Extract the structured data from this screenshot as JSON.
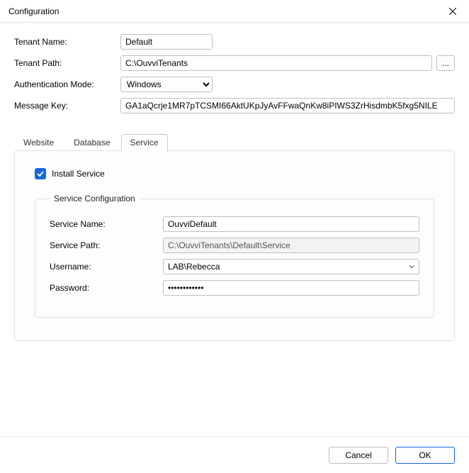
{
  "window": {
    "title": "Configuration"
  },
  "form": {
    "tenant_name_label": "Tenant Name:",
    "tenant_name_value": "Default",
    "tenant_path_label": "Tenant Path:",
    "tenant_path_value": "C:\\OuvviTenants",
    "browse_label": "...",
    "auth_mode_label": "Authentication Mode:",
    "auth_mode_value": "Windows",
    "message_key_label": "Message Key:",
    "message_key_value": "GA1aQcrje1MR7pTCSMI66AktUKpJyAvFFwaQnKw8iPIWS3ZrHisdmbK5fxg5NILE"
  },
  "tabs": {
    "website": "Website",
    "database": "Database",
    "service": "Service"
  },
  "service_tab": {
    "install_label": "Install Service",
    "install_checked": true,
    "group_title": "Service Configuration",
    "service_name_label": "Service Name:",
    "service_name_value": "OuvviDefault",
    "service_path_label": "Service Path:",
    "service_path_value": "C:\\OuvviTenants\\Default\\Service",
    "username_label": "Username:",
    "username_value": "LAB\\Rebecca",
    "password_label": "Password:",
    "password_value": "••••••••••••"
  },
  "footer": {
    "cancel": "Cancel",
    "ok": "OK"
  }
}
